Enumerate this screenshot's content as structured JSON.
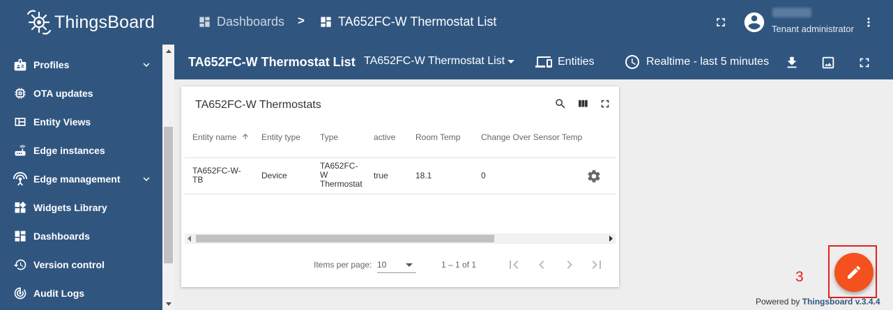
{
  "app": {
    "logo_text": "ThingsBoard"
  },
  "sidebar": {
    "items": [
      {
        "label": "Profiles",
        "icon": "profiles-icon",
        "expandable": true
      },
      {
        "label": "OTA updates",
        "icon": "memory-chip-icon",
        "expandable": false
      },
      {
        "label": "Entity Views",
        "icon": "view-quilt-icon",
        "expandable": false
      },
      {
        "label": "Edge instances",
        "icon": "router-icon",
        "expandable": false
      },
      {
        "label": "Edge management",
        "icon": "settings-input-antenna-icon",
        "expandable": true
      },
      {
        "label": "Widgets Library",
        "icon": "widgets-icon",
        "expandable": false
      },
      {
        "label": "Dashboards",
        "icon": "dashboard-icon",
        "expandable": false
      },
      {
        "label": "Version control",
        "icon": "history-icon",
        "expandable": false
      },
      {
        "label": "Audit Logs",
        "icon": "track-changes-icon",
        "expandable": false
      }
    ]
  },
  "header": {
    "breadcrumb": [
      {
        "label": "Dashboards"
      },
      {
        "label": "TA652FC-W Thermostat List"
      }
    ],
    "breadcrumb_separator": ">",
    "user_role": "Tenant administrator"
  },
  "toolbar": {
    "dashboard_title": "TA652FC-W Thermostat List",
    "state_selected": "TA652FC-W Thermostat List",
    "entities_label": "Entities",
    "timewindow_label": "Realtime - last 5 minutes"
  },
  "widget": {
    "title": "TA652FC-W Thermostats",
    "columns": [
      "Entity name",
      "Entity type",
      "Type",
      "active",
      "Room Temp",
      "Change Over Sensor Temp"
    ],
    "rows": [
      {
        "entity_name": [
          "TA652FC-W-",
          "TB"
        ],
        "entity_type": "Device",
        "type": [
          "TA652FC-",
          "W",
          "Thermostat"
        ],
        "active": "true",
        "room_temp": "18.1",
        "change_over": "0"
      }
    ],
    "pager": {
      "items_per_page_label": "Items per page:",
      "items_per_page_value": "10",
      "range": "1 – 1 of 1"
    }
  },
  "annotation": {
    "label": "3"
  },
  "footer": {
    "powered_prefix": "Powered by",
    "brand": "Thingsboard v.3.4.4"
  },
  "colors": {
    "primary": "#305680",
    "fab": "#f4511e",
    "annotation": "#e02020"
  }
}
